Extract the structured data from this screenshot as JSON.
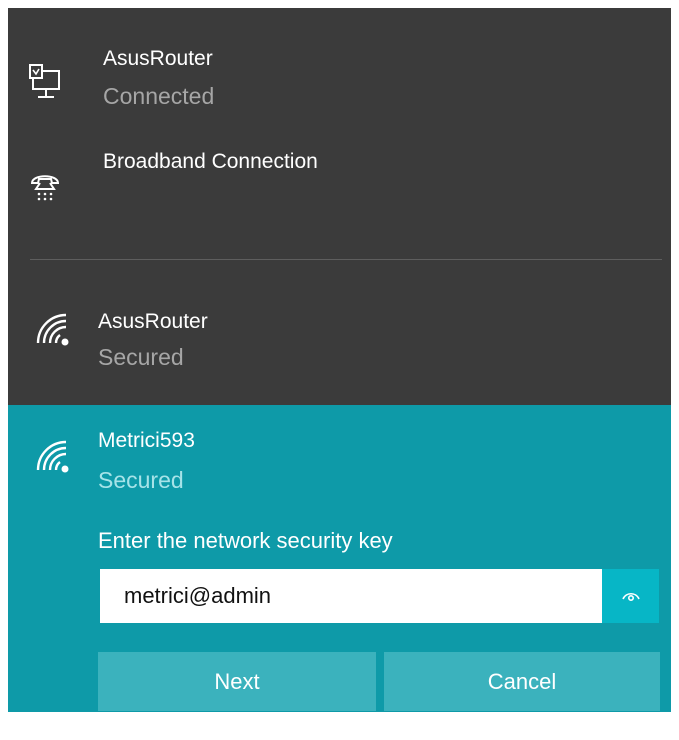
{
  "connections": [
    {
      "name": "AsusRouter",
      "status": "Connected",
      "icon": "ethernet-icon"
    },
    {
      "name": "Broadband Connection",
      "status": "",
      "icon": "dialup-icon"
    }
  ],
  "wifi_networks": [
    {
      "name": "AsusRouter",
      "status": "Secured",
      "icon": "wifi-secured-icon"
    }
  ],
  "selected_network": {
    "name": "Metrici593",
    "status": "Secured",
    "icon": "wifi-secured-icon",
    "prompt": "Enter the network security key",
    "key_value": "metrici@admin",
    "reveal_icon": "eye-icon",
    "next_label": "Next",
    "cancel_label": "Cancel"
  },
  "colors": {
    "panel": "#3b3b3b",
    "accent": "#0e9aa8",
    "button": "#3bb2bd",
    "reveal": "#07b6c6"
  }
}
